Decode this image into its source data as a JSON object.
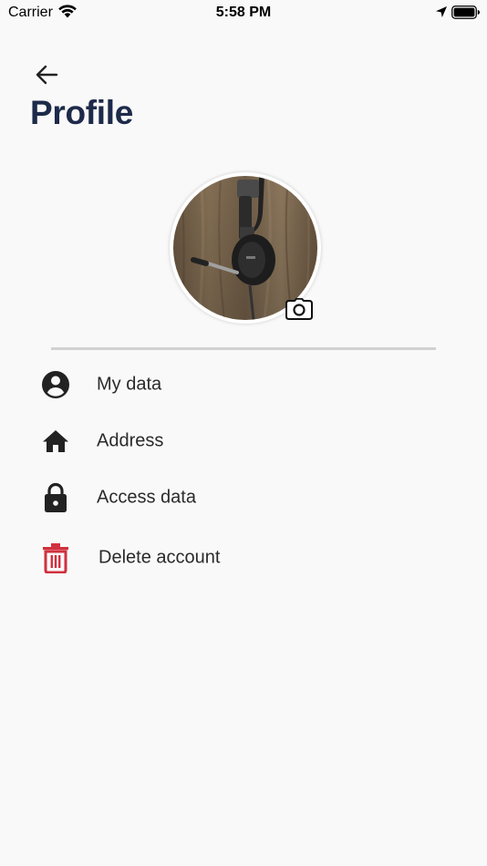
{
  "status_bar": {
    "carrier": "Carrier",
    "time": "5:58 PM",
    "icons": [
      "wifi-icon",
      "location-arrow-icon",
      "battery-icon"
    ]
  },
  "header": {
    "back_icon": "arrow-left-icon",
    "title": "Profile"
  },
  "avatar": {
    "edit_icon": "camera-icon"
  },
  "menu": {
    "items": [
      {
        "label": "My data",
        "icon": "account-circle-icon"
      },
      {
        "label": "Address",
        "icon": "home-icon"
      },
      {
        "label": "Access data",
        "icon": "lock-icon"
      },
      {
        "label": "Delete account",
        "icon": "trash-icon",
        "color": "#d0313f"
      }
    ]
  },
  "colors": {
    "title": "#1d2a4a",
    "background": "#f9f9f9",
    "icon": "#222222",
    "danger": "#d0313f",
    "divider": "#d2d2d2"
  }
}
